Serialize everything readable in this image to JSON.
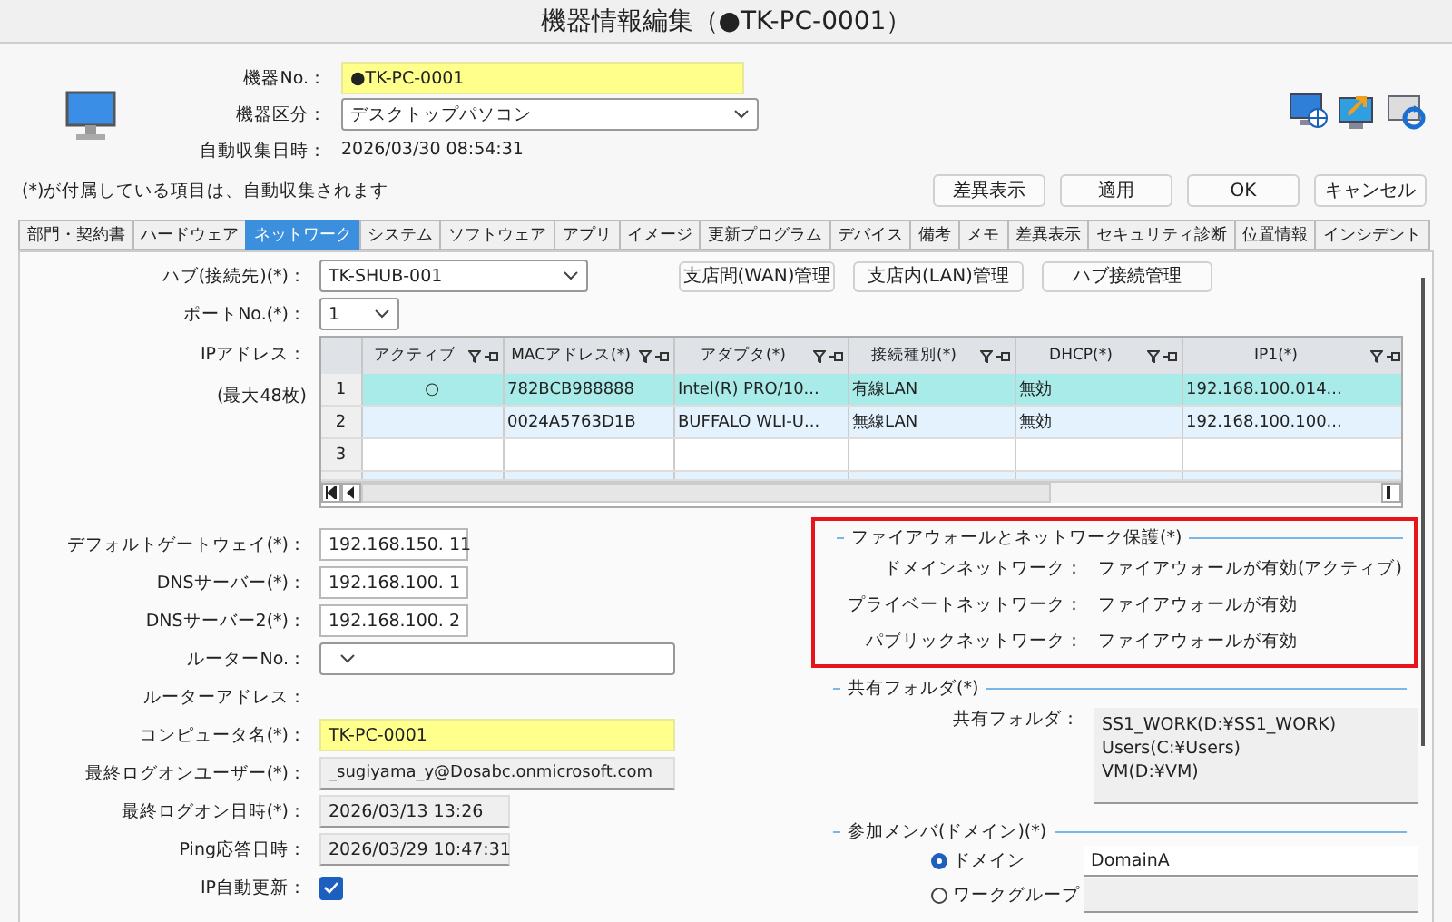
{
  "window": {
    "title": "機器情報編集（●TK-PC-0001）"
  },
  "header": {
    "fields": [
      {
        "label": "機器No.：",
        "value": "●TK-PC-0001",
        "kind": "highlight"
      },
      {
        "label": "機器区分：",
        "value": "デスクトップパソコン",
        "kind": "select"
      },
      {
        "label": "自動収集日時：",
        "value": "2026/03/30 08:54:31",
        "kind": "text"
      }
    ],
    "note": "(*)が付属している項目は、自動収集されます",
    "buttons": [
      "差異表示",
      "適用",
      "OK",
      "キャンセル"
    ]
  },
  "tabs": [
    {
      "label": "部門・契約書",
      "selected": false
    },
    {
      "label": "ハードウェア",
      "selected": false
    },
    {
      "label": "ネットワーク",
      "selected": true
    },
    {
      "label": "システム",
      "selected": false
    },
    {
      "label": "ソフトウェア",
      "selected": false
    },
    {
      "label": "アプリ",
      "selected": false
    },
    {
      "label": "イメージ",
      "selected": false
    },
    {
      "label": "更新プログラム",
      "selected": false
    },
    {
      "label": "デバイス",
      "selected": false
    },
    {
      "label": "備考",
      "selected": false
    },
    {
      "label": "メモ",
      "selected": false
    },
    {
      "label": "差異表示",
      "selected": false
    },
    {
      "label": "セキュリティ診断",
      "selected": false
    },
    {
      "label": "位置情報",
      "selected": false
    },
    {
      "label": "インシデント",
      "selected": false
    }
  ],
  "network": {
    "hub": {
      "label": "ハブ(接続先)(*)：",
      "value": "TK-SHUB-001"
    },
    "port": {
      "label": "ポートNo.(*)：",
      "value": "1"
    },
    "manage_buttons": [
      "支店間(WAN)管理",
      "支店内(LAN)管理",
      "ハブ接続管理"
    ],
    "ip_label": "IPアドレス：",
    "ip_note": "(最大48枚)",
    "grid": {
      "columns": [
        "アクティブ",
        "MACアドレス(*)",
        "アダプタ(*)",
        "接続種別(*)",
        "DHCP(*)",
        "IP1(*)"
      ],
      "rows": [
        {
          "number": "1",
          "selected": true,
          "cells": [
            "○",
            "782BCB988888",
            "Intel(R) PRO/10...",
            "有線LAN",
            "無効",
            "192.168.100.014..."
          ]
        },
        {
          "number": "2",
          "selected": false,
          "cells": [
            "",
            "0024A5763D1B",
            "BUFFALO WLI-U...",
            "無線LAN",
            "無効",
            "192.168.100.100..."
          ]
        },
        {
          "number": "3",
          "selected": false,
          "cells": [
            "",
            "",
            "",
            "",
            "",
            ""
          ]
        }
      ]
    }
  },
  "settings": [
    {
      "label": "デフォルトゲートウェイ(*)：",
      "value": "192.168.150. 11",
      "kind": "input"
    },
    {
      "label": "DNSサーバー(*)：",
      "value": "192.168.100.  1",
      "kind": "input"
    },
    {
      "label": "DNSサーバー2(*)：",
      "value": "192.168.100.  2",
      "kind": "input"
    },
    {
      "label": "ルーターNo.：",
      "kind": "select"
    },
    {
      "label": "ルーターアドレス：",
      "kind": "plain"
    },
    {
      "label": "コンピュータ名(*)：",
      "value": "TK-PC-0001",
      "kind": "highlight"
    },
    {
      "label": "最終ログオンユーザー(*)：",
      "value": "_sugiyama_y@Dosabc.onmicrosoft.com",
      "kind": "readonly"
    },
    {
      "label": "最終ログオン日時(*)：",
      "value": "2026/03/13 13:26",
      "kind": "readonly_short"
    },
    {
      "label": "Ping応答日時：",
      "value": "2026/03/29 10:47:31",
      "kind": "readonly_short"
    },
    {
      "label": "IP自動更新：",
      "kind": "checkbox",
      "checked": true
    }
  ],
  "firewall": {
    "title": "ファイアウォールとネットワーク保護(*)",
    "rows": [
      {
        "label": "ドメインネットワーク：",
        "value": "ファイアウォールが有効(アクティブ)"
      },
      {
        "label": "プライベートネットワーク：",
        "value": "ファイアウォールが有効"
      },
      {
        "label": "パブリックネットワーク：",
        "value": "ファイアウォールが有効"
      }
    ]
  },
  "shared_folders": {
    "title": "共有フォルダ(*)",
    "label": "共有フォルダ：",
    "values": [
      "SS1_WORK(D:¥SS1_WORK)",
      "Users(C:¥Users)",
      "VM(D:¥VM)"
    ]
  },
  "membership": {
    "title": "参加メンバ(ドメイン)(*)",
    "options": [
      {
        "label": "ドメイン",
        "selected": true,
        "value": "DomainA"
      },
      {
        "label": "ワークグループ",
        "selected": false
      }
    ]
  }
}
